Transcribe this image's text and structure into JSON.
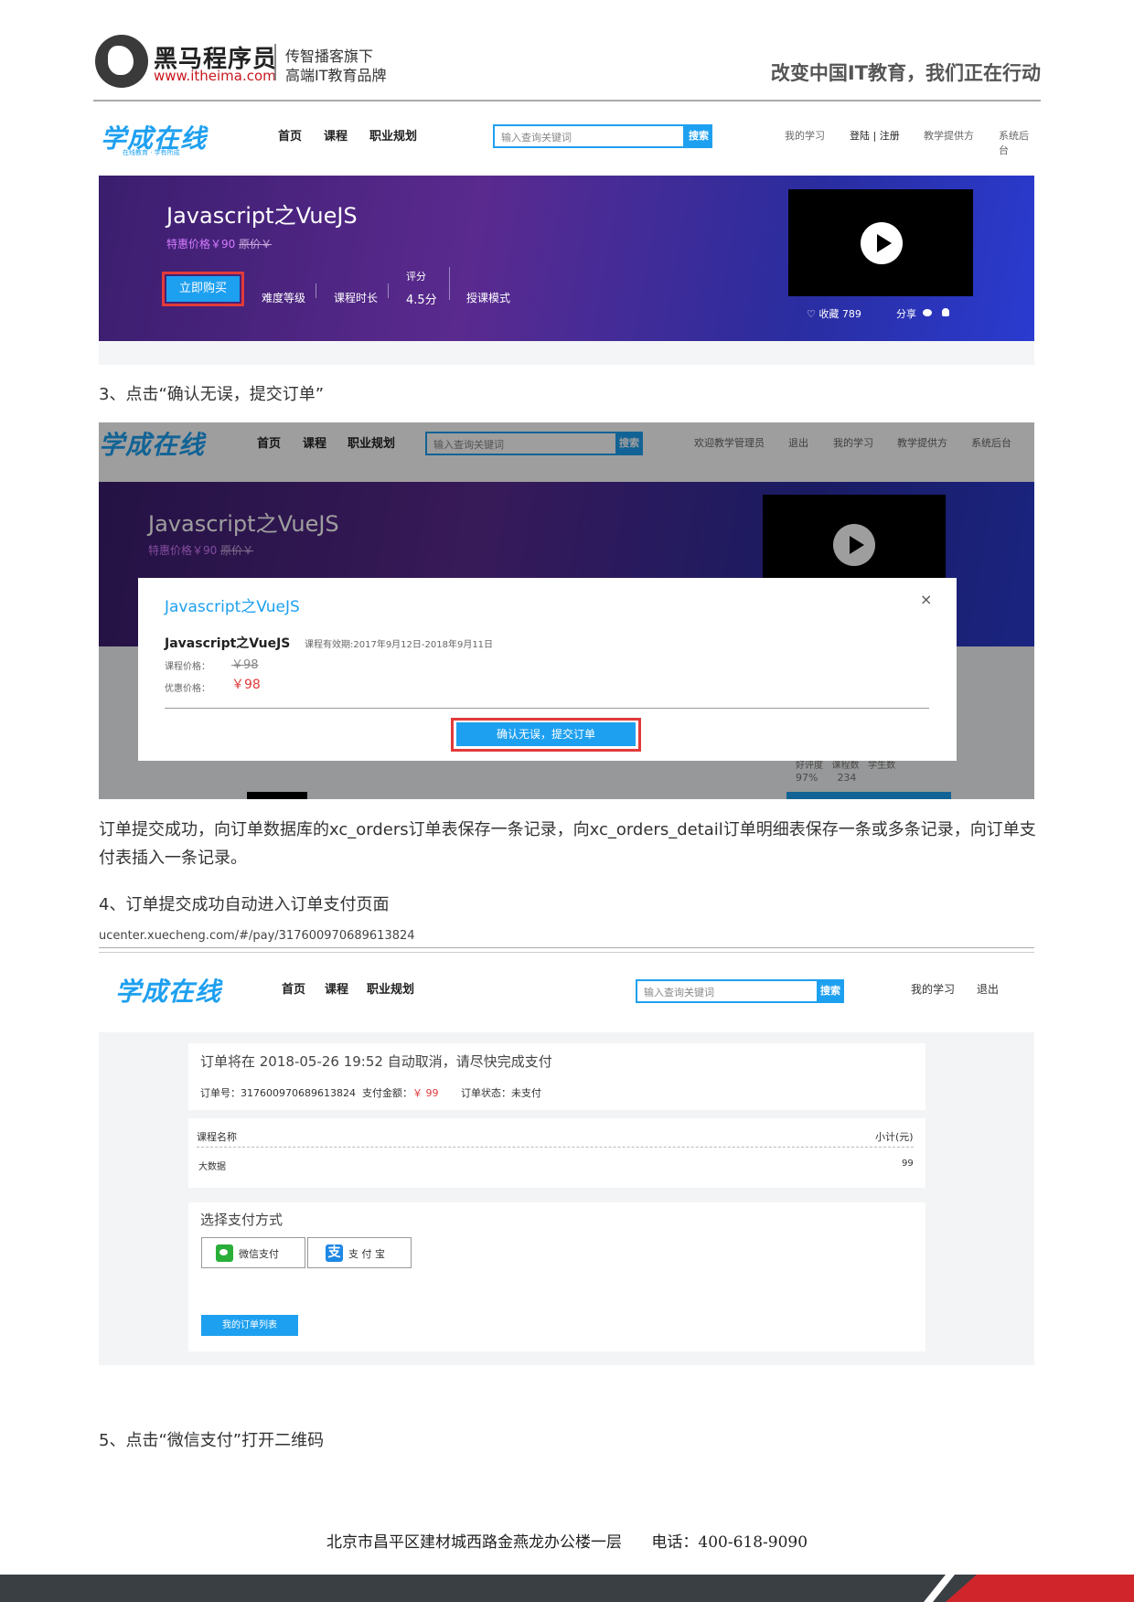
{
  "header": {
    "brand_cn": "黑马程序员",
    "brand_url": "www.itheima.com",
    "brand_sub1": "传智播客旗下",
    "brand_sub2": "高端IT教育品牌",
    "slogan": "改变中国IT教育，我们正在行动"
  },
  "site": {
    "logo": "学成在线",
    "logo_sub": "在线教育 · 学有所成",
    "nav": [
      "首页",
      "课程",
      "职业规划"
    ],
    "search_placeholder": "输入查询关键词",
    "search_button": "搜索"
  },
  "shot1": {
    "top_links": [
      "我的学习",
      "登陆 | 注册",
      "教学提供方",
      "系统后台"
    ],
    "course_title": "Javascript之VueJS",
    "price_label": "特惠价格￥90",
    "original_price": "原价￥",
    "buy_button": "立即购买",
    "meta": {
      "difficulty": "难度等级",
      "duration": "课程时长",
      "rating_label": "评分",
      "rating_value": "4.5分",
      "mode": "授课模式"
    },
    "favorite": "♡ 收藏 789",
    "share": "分享"
  },
  "step3": "3、点击“确认无误，提交订单”",
  "shot2": {
    "top_links": [
      "欢迎教学管理员",
      "退出",
      "我的学习",
      "教学提供方",
      "系统后台"
    ],
    "course_title": "Javascript之VueJS",
    "price_label": "特惠价格￥90",
    "original_price": "原价￥",
    "modal": {
      "title": "Javascript之VueJS",
      "close": "×",
      "course": "Javascript之VueJS",
      "validity": "课程有效期:2017年9月12日-2018年9月11日",
      "price_label": "课程价格：",
      "price": "￥98",
      "discount_label": "优惠价格：",
      "discount": "￥98",
      "confirm": "确认无误，提交订单"
    },
    "bg_stats": {
      "labels": [
        "好评度",
        "课程数",
        "学生数"
      ],
      "values": [
        "97%",
        "234"
      ]
    }
  },
  "paragraph": "订单提交成功，向订单数据库的xc_orders订单表保存一条记录，向xc_orders_detail订单明细表保存一条或多条记录，向订单支付表插入一条记录。",
  "step4": "4、订单提交成功自动进入订单支付页面",
  "shot3": {
    "url": "ucenter.xuecheng.com/#/pay/317600970689613824",
    "top_links": [
      "我的学习",
      "退出"
    ],
    "order_notice": "订单将在 2018-05-26 19:52 自动取消，请尽快完成支付",
    "order_no_label": "订单号：",
    "order_no": "317600970689613824",
    "amount_label": "支付金额：",
    "amount": "￥ 99",
    "status_label": "订单状态：",
    "status": "未支付",
    "col_name": "课程名称",
    "col_subtotal": "小计(元)",
    "item_name": "大数据",
    "item_subtotal": "99",
    "pay_method_title": "选择支付方式",
    "wechat_pay": "微信支付",
    "alipay": "支 付 宝",
    "my_orders": "我的订单列表"
  },
  "step5": "5、点击“微信支付”打开二维码",
  "footer": {
    "address": "北京市昌平区建材城西路金燕龙办公楼一层",
    "phone": "电话：400-618-9090"
  },
  "colors": {
    "accent": "#1ea0f0",
    "red": "#e23a3a",
    "banner_purple": "#5a2a8f",
    "footer_dark": "#3a3f44",
    "footer_red": "#d0262b"
  }
}
